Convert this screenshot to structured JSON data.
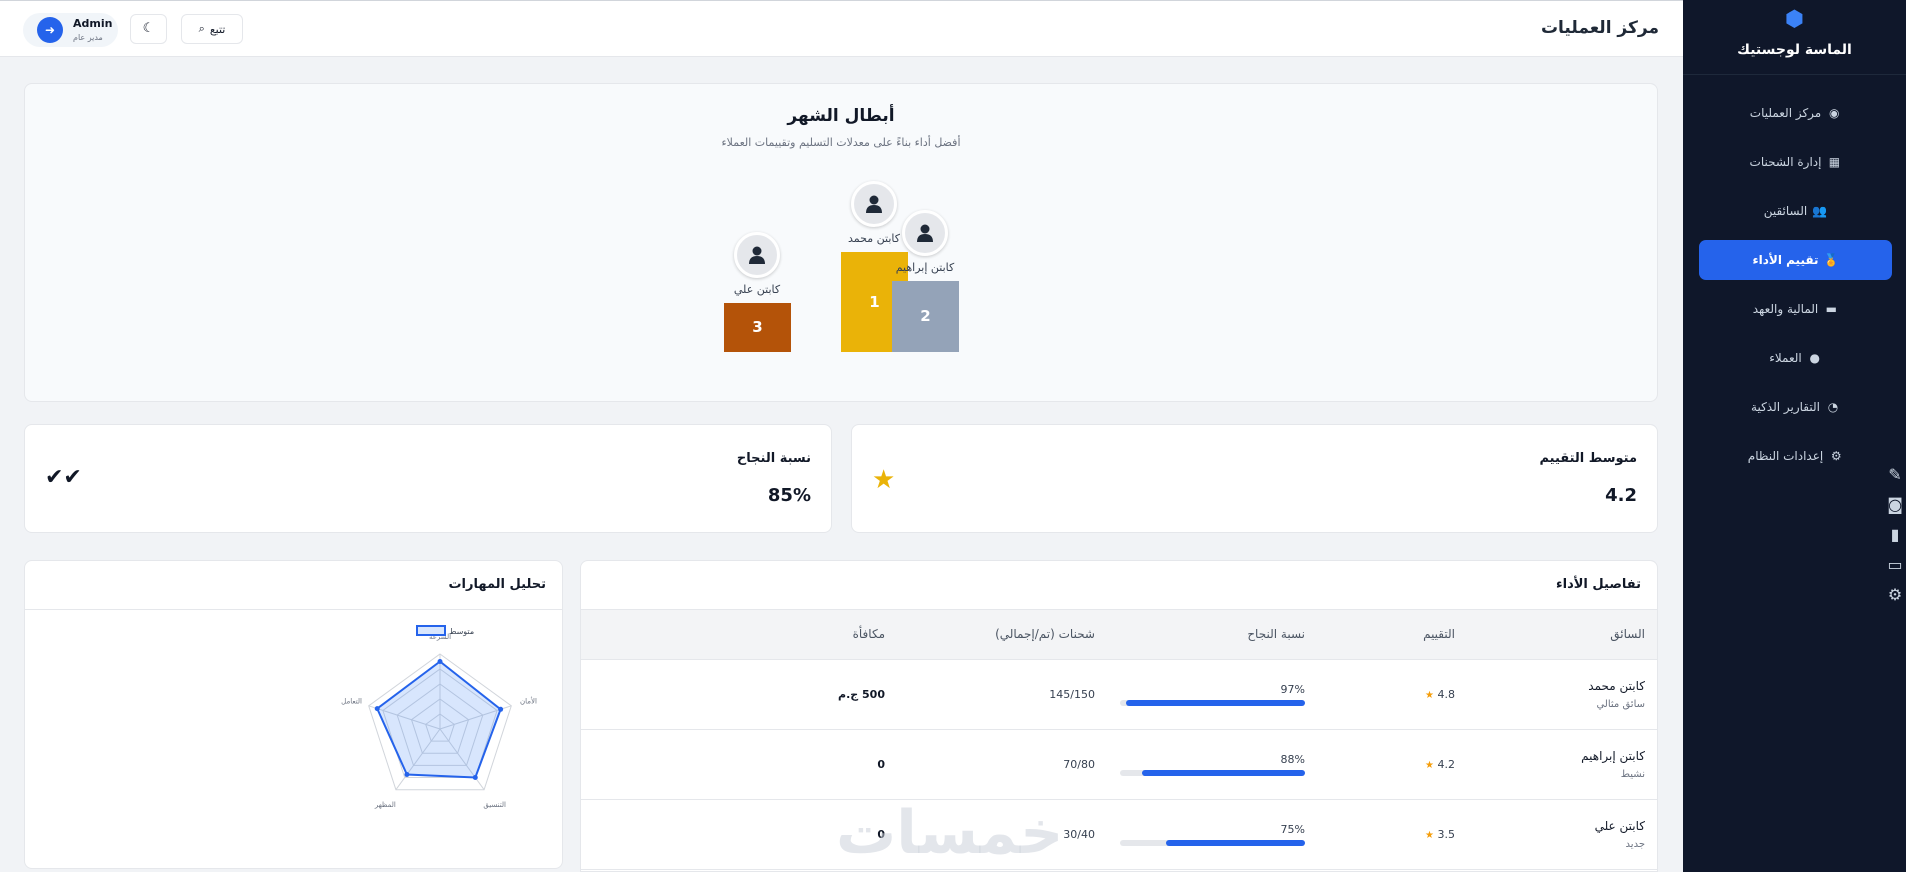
{
  "sidebar": {
    "brand": "الماسة لوجستيك",
    "items": [
      {
        "label": "مركز العمليات",
        "icon": "satellite-dish-icon",
        "glyph": "◉",
        "active": false
      },
      {
        "label": "إدارة الشحنات",
        "icon": "boxes-icon",
        "glyph": "▦",
        "active": false
      },
      {
        "label": "السائقين",
        "icon": "users-icon",
        "glyph": "👥",
        "active": false
      },
      {
        "label": "تقييم الأداء",
        "icon": "medal-icon",
        "glyph": "🏅",
        "active": true
      },
      {
        "label": "المالية والعهد",
        "icon": "wallet-icon",
        "glyph": "▬",
        "active": false
      },
      {
        "label": "العملاء",
        "icon": "user-tie-icon",
        "glyph": "●",
        "active": false
      },
      {
        "label": "التقارير الذكية",
        "icon": "chart-pie-icon",
        "glyph": "◔",
        "active": false
      },
      {
        "label": "إعدادات النظام",
        "icon": "gear-icon",
        "glyph": "⚙",
        "active": false
      }
    ]
  },
  "header": {
    "title": "مركز العمليات",
    "track_label": "تتبع",
    "user_name": "Admin",
    "user_role": "مدير عام"
  },
  "champions": {
    "title": "أبطال الشهر",
    "subtitle": "أفضل أداء بناءً على معدلات التسليم وتقييمات العملاء",
    "podium": [
      {
        "rank": "1",
        "name": "كابتن محمد",
        "color": "#eab308",
        "height_fraction": 1.0
      },
      {
        "rank": "2",
        "name": "كابتن إبراهيم",
        "color": "#94a3b8",
        "height_fraction": 0.71
      },
      {
        "rank": "3",
        "name": "كابتن علي",
        "color": "#b45309",
        "height_fraction": 0.49
      }
    ]
  },
  "stats": {
    "avg_rating_label": "متوسط التقييم",
    "avg_rating_value": "4.2",
    "success_label": "نسبة النجاح",
    "success_value": "85%"
  },
  "performance": {
    "title": "تفاصيل الأداء",
    "columns": [
      "السائق",
      "التقييم",
      "نسبة النجاح",
      "شحنات (تم/إجمالي)",
      "مكافأة"
    ],
    "rows": [
      {
        "name": "كابتن محمد",
        "status": "سائق مثالي",
        "rating": "4.8",
        "success": "97%",
        "success_fraction": 0.97,
        "shipments": "145/150",
        "bonus": "500 ج.م"
      },
      {
        "name": "كابتن إبراهيم",
        "status": "نشيط",
        "rating": "4.2",
        "success": "88%",
        "success_fraction": 0.88,
        "shipments": "70/80",
        "bonus": "0"
      },
      {
        "name": "كابتن علي",
        "status": "جديد",
        "rating": "3.5",
        "success": "75%",
        "success_fraction": 0.75,
        "shipments": "30/40",
        "bonus": "0"
      }
    ]
  },
  "skills": {
    "title": "تحليل المهارات",
    "chart_data": {
      "type": "radar",
      "categories": [
        "السرعة",
        "الأمان",
        "التنسيق",
        "المظهر",
        "التعامل"
      ],
      "series": [
        {
          "name": "متوسط",
          "values": [
            90,
            85,
            80,
            75,
            88
          ]
        }
      ],
      "range": [
        0,
        100
      ],
      "legend": "top"
    }
  },
  "watermark": "خمسات",
  "colors": {
    "accent": "#2563eb",
    "sidebar_bg": "#0f172a"
  }
}
